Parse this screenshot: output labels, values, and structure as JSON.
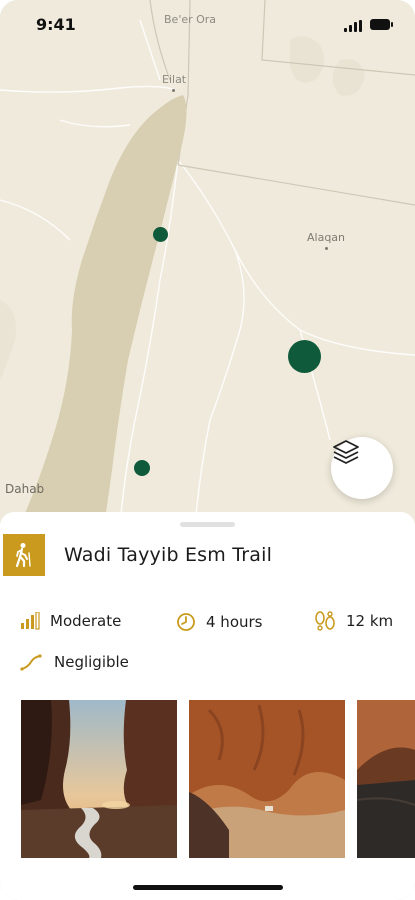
{
  "status_bar": {
    "time": "9:41"
  },
  "map": {
    "places": [
      {
        "name": "Be'er Ora"
      },
      {
        "name": "Eilat"
      },
      {
        "name": "Alaqan"
      },
      {
        "name": "Dahab"
      }
    ],
    "colors": {
      "land": "#efeadb",
      "water": "#d8ceb1",
      "marker": "#0f5a3a",
      "roads": "#ffffff"
    }
  },
  "layers_button": {
    "icon": "layers-icon"
  },
  "trail": {
    "title": "Wadi Tayyib Esm Trail",
    "icon": "hiker-icon",
    "accent": "#c99a1e",
    "difficulty": "Moderate",
    "duration": "4 hours",
    "distance": "12 km",
    "elevation": "Negligible"
  },
  "photos": [
    {
      "description": "canyon-stream-sunset"
    },
    {
      "description": "red-rock-cliffs"
    },
    {
      "description": "canyon-partial"
    }
  ]
}
